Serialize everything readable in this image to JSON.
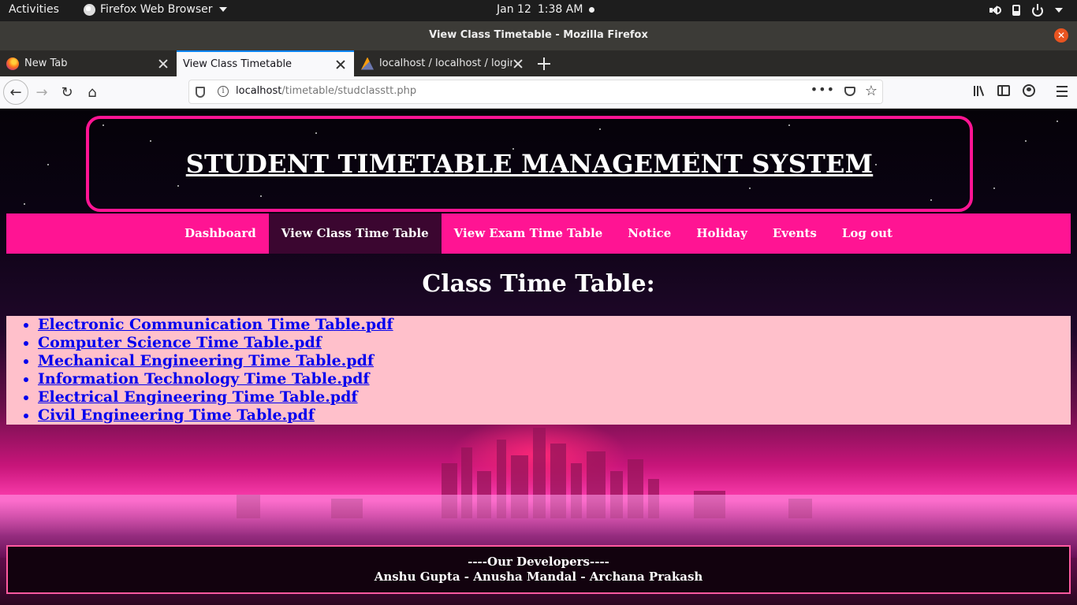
{
  "system_bar": {
    "activities": "Activities",
    "app_name": "Firefox Web Browser",
    "date": "Jan 12",
    "time": "1:38 AM"
  },
  "window": {
    "title": "View Class Timetable - Mozilla Firefox"
  },
  "tabs": [
    {
      "label": "New Tab",
      "active": false
    },
    {
      "label": "View Class Timetable",
      "active": true
    },
    {
      "label": "localhost / localhost / login",
      "active": false
    }
  ],
  "urlbar": {
    "host": "localhost",
    "path": "/timetable/studclasstt.php"
  },
  "page": {
    "site_title": "STUDENT TIMETABLE MANAGEMENT SYSTEM",
    "nav": [
      {
        "label": "Dashboard",
        "current": false
      },
      {
        "label": "View Class Time Table",
        "current": true
      },
      {
        "label": "View Exam Time Table",
        "current": false
      },
      {
        "label": "Notice",
        "current": false
      },
      {
        "label": "Holiday",
        "current": false
      },
      {
        "label": "Events",
        "current": false
      },
      {
        "label": "Log out",
        "current": false
      }
    ],
    "section_title": "Class Time Table:",
    "files": [
      "Electronic Communication Time Table.pdf",
      "Computer Science Time Table.pdf",
      "Mechanical Engineering Time Table.pdf",
      "Information Technology Time Table.pdf",
      "Electrical Engineering Time Table.pdf",
      "Civil Engineering Time Table.pdf"
    ],
    "footer": {
      "heading": "----Our Developers----",
      "names": "Anshu Gupta - Anusha Mandal - Archana Prakash"
    }
  },
  "colors": {
    "accent": "#ff1493",
    "nav_current": "#3b0630",
    "list_bg": "#ffc0cb",
    "link": "#0000ee",
    "tab_indicator": "#0a84ff",
    "window_close": "#e95420"
  }
}
